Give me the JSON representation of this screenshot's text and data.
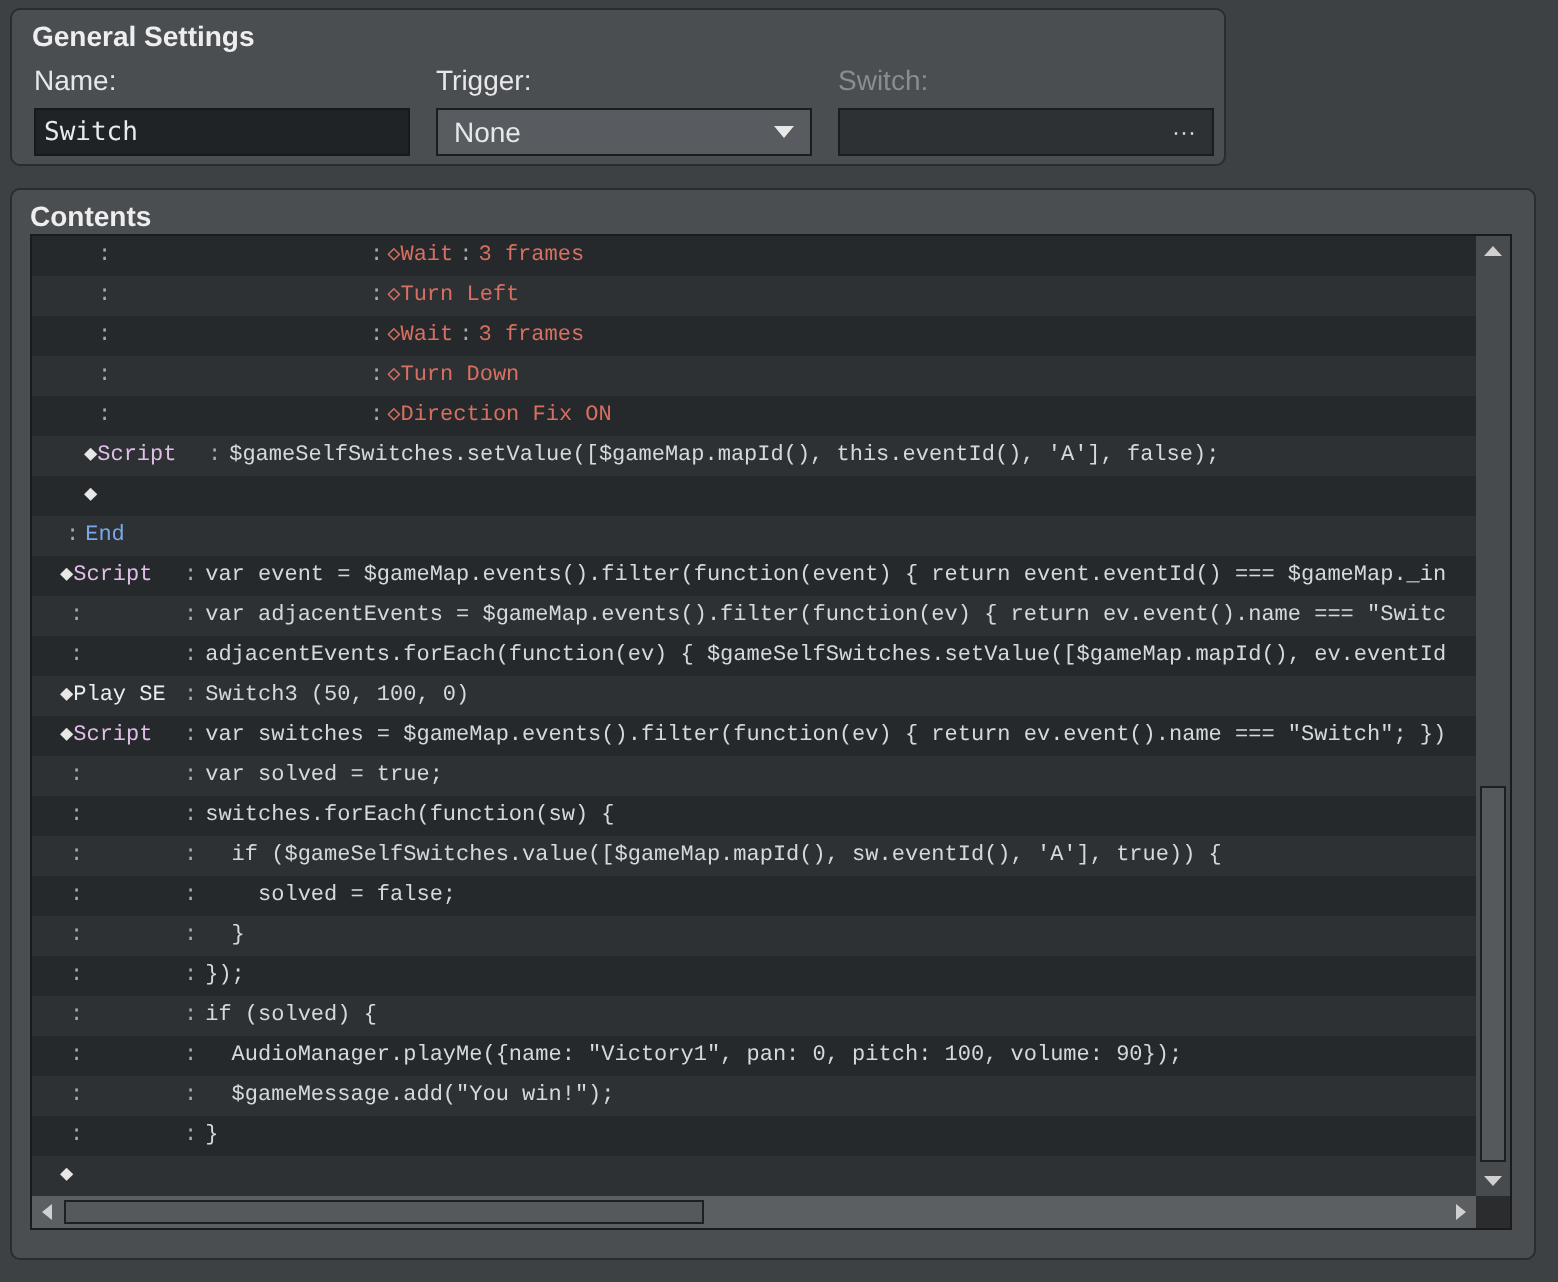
{
  "general_settings": {
    "title": "General Settings",
    "fields": [
      {
        "kind": "text",
        "label": "Name:",
        "value": "Switch",
        "disabled": false
      },
      {
        "kind": "select",
        "label": "Trigger:",
        "value": "None",
        "disabled": false
      },
      {
        "kind": "picker",
        "label": "Switch:",
        "button": "···",
        "disabled": true
      }
    ]
  },
  "contents": {
    "title": "Contents",
    "commands": [
      {
        "kind": "block",
        "children": [
          {
            "kind": "route",
            "steps": [
              {
                "mark": ":",
                "sep": ":",
                "label": "◇Wait",
                "arg_sep": ":",
                "arg": "3 frames"
              },
              {
                "mark": ":",
                "sep": ":",
                "label": "◇Turn Left"
              },
              {
                "mark": ":",
                "sep": ":",
                "label": "◇Wait",
                "arg_sep": ":",
                "arg": "3 frames"
              },
              {
                "mark": ":",
                "sep": ":",
                "label": "◇Turn Down"
              },
              {
                "mark": ":",
                "sep": ":",
                "label": "◇Direction Fix ON"
              }
            ]
          },
          {
            "kind": "script",
            "bullet": "◆",
            "label": "Script",
            "sep": ":",
            "lines": [
              {
                "text": "$gameSelfSwitches.setValue([$gameMap.mapId(), this.eventId(), 'A'], false);"
              }
            ]
          },
          {
            "kind": "empty",
            "bullet": "◆"
          }
        ]
      },
      {
        "kind": "end",
        "mark": ":",
        "label": "End"
      },
      {
        "kind": "script",
        "bullet": "◆",
        "label": "Script",
        "sep": ":",
        "lines": [
          {
            "text": "var event = $gameMap.events().filter(function(event) { return event.eventId() === $gameMap._in"
          },
          {
            "mark": ":",
            "sep": ":",
            "text": "var adjacentEvents = $gameMap.events().filter(function(ev) { return ev.event().name === \"Switc"
          },
          {
            "mark": ":",
            "sep": ":",
            "text": "adjacentEvents.forEach(function(ev) { $gameSelfSwitches.setValue([$gameMap.mapId(), ev.eventId"
          }
        ]
      },
      {
        "kind": "play_se",
        "bullet": "◆",
        "label": "Play SE",
        "sep": ":",
        "lines": [
          {
            "text": "Switch3 (50, 100, 0)"
          }
        ]
      },
      {
        "kind": "script",
        "bullet": "◆",
        "label": "Script",
        "sep": ":",
        "lines": [
          {
            "text": "var switches = $gameMap.events().filter(function(ev) { return ev.event().name === \"Switch\"; })"
          },
          {
            "mark": ":",
            "sep": ":",
            "text": "var solved = true;"
          },
          {
            "mark": ":",
            "sep": ":",
            "text": "switches.forEach(function(sw) {"
          },
          {
            "mark": ":",
            "sep": ":",
            "text": "  if ($gameSelfSwitches.value([$gameMap.mapId(), sw.eventId(), 'A'], true)) {"
          },
          {
            "mark": ":",
            "sep": ":",
            "text": "    solved = false;"
          },
          {
            "mark": ":",
            "sep": ":",
            "text": "  }"
          },
          {
            "mark": ":",
            "sep": ":",
            "text": "});"
          },
          {
            "mark": ":",
            "sep": ":",
            "text": "if (solved) {"
          },
          {
            "mark": ":",
            "sep": ":",
            "text": "  AudioManager.playMe({name: \"Victory1\", pan: 0, pitch: 100, volume: 90});"
          },
          {
            "mark": ":",
            "sep": ":",
            "text": "  $gameMessage.add(\"You win!\");"
          },
          {
            "mark": ":",
            "sep": ":",
            "text": "}"
          }
        ]
      },
      {
        "kind": "empty",
        "bullet": "◆"
      }
    ]
  }
}
